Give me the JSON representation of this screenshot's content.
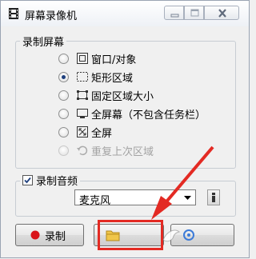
{
  "window": {
    "title": "屏幕录像机",
    "controls": [
      "minimize",
      "maximize",
      "close"
    ]
  },
  "record_group": {
    "legend": "录制屏幕",
    "options": [
      {
        "label": "窗口/对象",
        "icon": "window-target-icon",
        "selected": false,
        "enabled": true
      },
      {
        "label": "矩形区域",
        "icon": "rectangle-select-icon",
        "selected": true,
        "enabled": true
      },
      {
        "label": "固定区域大小",
        "icon": "fixed-region-icon",
        "selected": false,
        "enabled": true
      },
      {
        "label": "全屏幕（不包含任务栏）",
        "icon": "monitor-icon",
        "selected": false,
        "enabled": true
      },
      {
        "label": "全屏",
        "icon": "fullscreen-icon",
        "selected": false,
        "enabled": true
      },
      {
        "label": "重复上次区域",
        "icon": "repeat-region-icon",
        "selected": false,
        "enabled": false
      }
    ]
  },
  "audio_group": {
    "legend": "录制音频",
    "checked": true,
    "device_selected": "麦克风"
  },
  "buttons": {
    "record": "录制",
    "files": "",
    "options": ""
  },
  "colors": {
    "highlight": "#e32a23",
    "record_dot": "#d9141a"
  }
}
